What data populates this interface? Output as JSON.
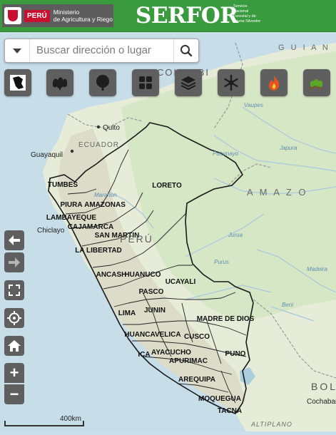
{
  "header": {
    "country": "PERÚ",
    "ministry_line1": "Ministerio",
    "ministry_line2": "de Agricultura y Riego",
    "brand": "SERFOR",
    "brand_sub": "Servicio Nacional Forestal y de Fauna Silvestre"
  },
  "search": {
    "placeholder": "Buscar dirección o lugar"
  },
  "toolbar": {
    "icons": [
      "peru-map-icon",
      "forest-cover-icon",
      "tree-icon",
      "fields-icon",
      "layers-icon",
      "snowflake-icon",
      "fire-icon",
      "deforestation-icon"
    ]
  },
  "map": {
    "regions": [
      "TUMBES",
      "PIURA",
      "AMAZONAS",
      "LAMBAYEQUE",
      "CAJAMARCA",
      "SAN MARTIN",
      "LA LIBERTAD",
      "LORETO",
      "ANCASH",
      "HUANUCO",
      "UCAYALI",
      "PASCO",
      "LIMA",
      "JUNIN",
      "MADRE DE DIOS",
      "HUANCAVELICA",
      "CUSCO",
      "ICA",
      "AYACUCHO",
      "APURIMAC",
      "PUNO",
      "AREQUIPA",
      "MOQUEGUA",
      "TACNA"
    ],
    "places": [
      "Quito",
      "Guayaquil",
      "Chiclayo",
      "Cochabamb"
    ],
    "countries": [
      "ECUADOR",
      "PERÚ",
      "A M A Z O",
      "G U I A N",
      "BOL",
      "ALTIPLANO",
      "COLOMBI"
    ],
    "rivers": [
      "Putumayo",
      "Japura",
      "Vaupes",
      "Maranon",
      "Purus",
      "Jurua",
      "Madeira",
      "Beni"
    ]
  },
  "controls": {
    "back_label": "←",
    "forward_label": "→",
    "zoom_in_label": "+",
    "zoom_out_label": "−"
  },
  "scale": {
    "label": "400km"
  }
}
